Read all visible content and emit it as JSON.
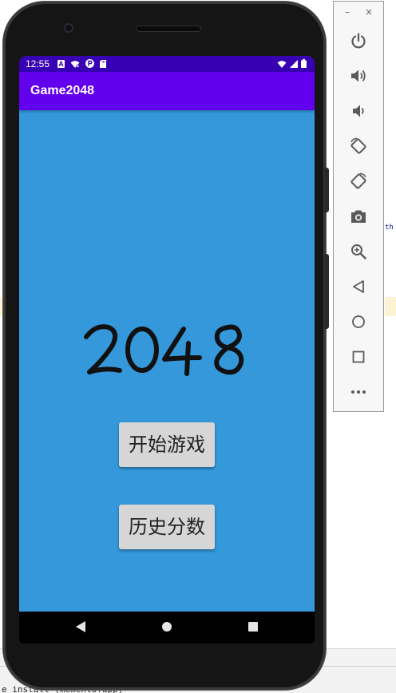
{
  "ide": {
    "fragment_right": "th",
    "console_text": "e install (memento.app)"
  },
  "status_bar": {
    "time": "12:55",
    "left_icons": [
      "a-notification-icon",
      "wifi-settings-icon",
      "p-notification-icon",
      "sd-card-icon"
    ],
    "right_icons": [
      "wifi-icon",
      "signal-icon",
      "battery-icon"
    ]
  },
  "app_bar": {
    "title": "Game2048"
  },
  "main": {
    "logo_text": "2048",
    "start_button_label": "开始游戏",
    "history_button_label": "历史分数"
  },
  "nav_bar": {
    "items": [
      "back-icon",
      "home-icon",
      "recents-icon"
    ]
  },
  "emulator_toolbar": {
    "window_minimize": "–",
    "window_close": "×",
    "buttons": [
      "power-icon",
      "volume-up-icon",
      "volume-down-icon",
      "rotate-left-icon",
      "rotate-right-icon",
      "camera-icon",
      "zoom-icon",
      "back-icon",
      "home-icon",
      "overview-icon",
      "more-icon"
    ]
  },
  "colors": {
    "status_bar": "#3700b3",
    "app_bar": "#6200ee",
    "screen_background": "#3498db",
    "button_background": "#d6d6d6"
  }
}
